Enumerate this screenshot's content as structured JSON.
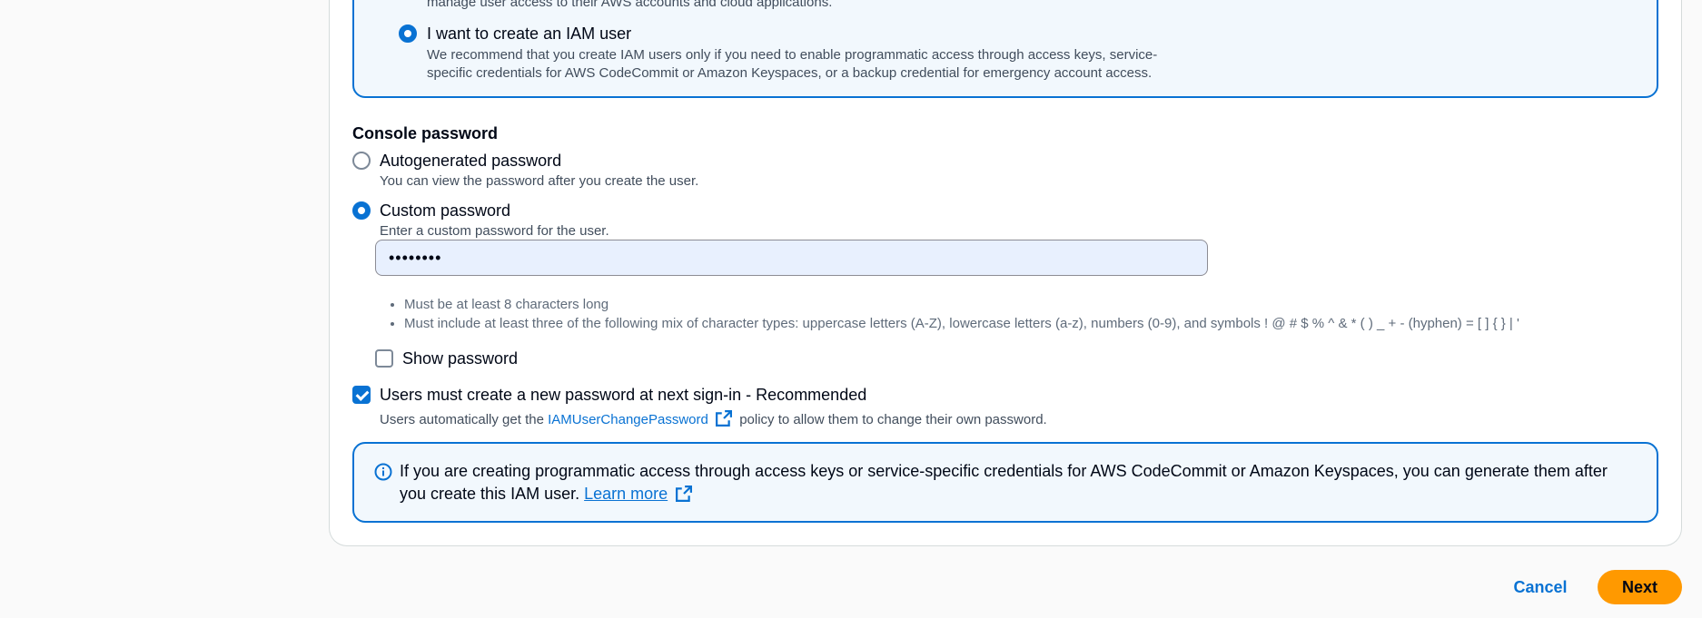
{
  "identity_center_option": {
    "desc_cut": "manage user access to their AWS accounts and cloud applications."
  },
  "iam_user_option": {
    "label": "I want to create an IAM user",
    "desc_line1": "We recommend that you create IAM users only if you need to enable programmatic access through access keys, service-",
    "desc_line2": "specific credentials for AWS CodeCommit or Amazon Keyspaces, or a backup credential for emergency account access.",
    "selected": true
  },
  "console_password": {
    "title": "Console password",
    "autogenerated": {
      "label": "Autogenerated password",
      "desc": "You can view the password after you create the user.",
      "selected": false
    },
    "custom": {
      "label": "Custom password",
      "desc": "Enter a custom password for the user.",
      "selected": true,
      "value": "••••••••"
    },
    "rules": [
      "Must be at least 8 characters long",
      "Must include at least three of the following mix of character types: uppercase letters (A-Z), lowercase letters (a-z), numbers (0-9), and symbols ! @ # $ % ^ & * ( ) _ + - (hyphen) = [ ] { } | '"
    ],
    "show_password": {
      "label": "Show password",
      "checked": false
    },
    "must_reset": {
      "label": "Users must create a new password at next sign-in - Recommended",
      "checked": true,
      "desc_prefix": "Users automatically get the",
      "desc_link": "IAMUserChangePassword",
      "desc_suffix": "policy to allow them to change their own password."
    }
  },
  "info_alert": {
    "text": "If you are creating programmatic access through access keys or service-specific credentials for AWS CodeCommit or Amazon Keyspaces, you can generate them after you create this IAM user.",
    "link": "Learn more"
  },
  "footer": {
    "cancel_label": "Cancel",
    "next_label": "Next"
  },
  "colors": {
    "accent": "#0972d3",
    "primary_button": "#ff9900",
    "info_background": "#f2f8fd"
  }
}
